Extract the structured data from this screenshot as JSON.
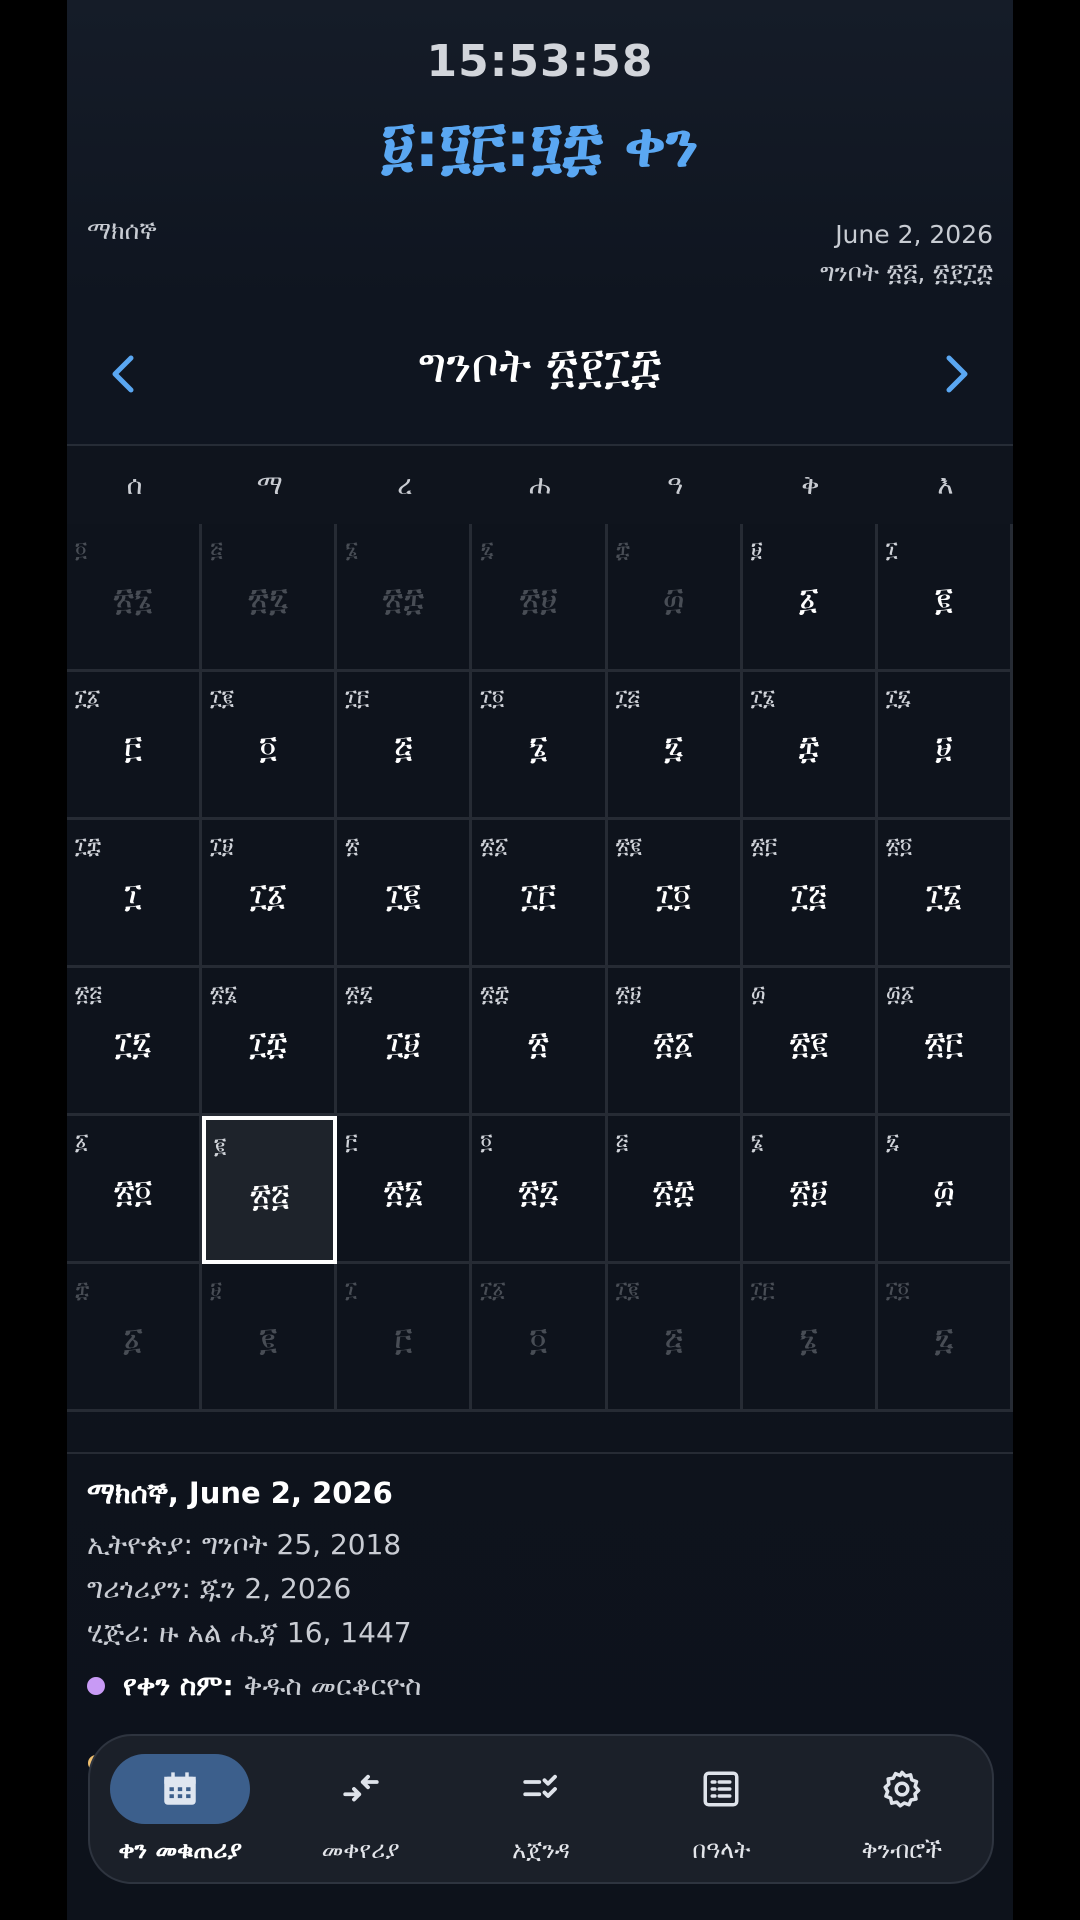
{
  "header": {
    "clock": "15:53:58",
    "title": "፱:፶፫:፶፰ ቀን",
    "weekday": "ማክሰኞ",
    "gregorian_date": "June 2, 2026",
    "ethiopian_date": "ግንቦት ፳፭, ፳፻፲፰"
  },
  "calendar": {
    "month_title": "ግንቦት ፳፻፲፰",
    "weekdays": [
      "ሰ",
      "ማ",
      "ረ",
      "ሐ",
      "ዓ",
      "ቅ",
      "እ"
    ],
    "weeks": [
      [
        {
          "s": "፬",
          "b": "፳፮",
          "o": true
        },
        {
          "s": "፭",
          "b": "፳፯",
          "o": true
        },
        {
          "s": "፮",
          "b": "፳፰",
          "o": true
        },
        {
          "s": "፯",
          "b": "፳፱",
          "o": true
        },
        {
          "s": "፰",
          "b": "፴",
          "o": true
        },
        {
          "s": "፱",
          "b": "፩",
          "o": false
        },
        {
          "s": "፲",
          "b": "፪",
          "o": false
        }
      ],
      [
        {
          "s": "፲፩",
          "b": "፫",
          "o": false
        },
        {
          "s": "፲፪",
          "b": "፬",
          "o": false
        },
        {
          "s": "፲፫",
          "b": "፭",
          "o": false
        },
        {
          "s": "፲፬",
          "b": "፮",
          "o": false
        },
        {
          "s": "፲፭",
          "b": "፯",
          "o": false
        },
        {
          "s": "፲፮",
          "b": "፰",
          "o": false
        },
        {
          "s": "፲፯",
          "b": "፱",
          "o": false
        }
      ],
      [
        {
          "s": "፲፰",
          "b": "፲",
          "o": false
        },
        {
          "s": "፲፱",
          "b": "፲፩",
          "o": false
        },
        {
          "s": "፳",
          "b": "፲፪",
          "o": false
        },
        {
          "s": "፳፩",
          "b": "፲፫",
          "o": false
        },
        {
          "s": "፳፪",
          "b": "፲፬",
          "o": false
        },
        {
          "s": "፳፫",
          "b": "፲፭",
          "o": false
        },
        {
          "s": "፳፬",
          "b": "፲፮",
          "o": false
        }
      ],
      [
        {
          "s": "፳፭",
          "b": "፲፯",
          "o": false
        },
        {
          "s": "፳፮",
          "b": "፲፰",
          "o": false
        },
        {
          "s": "፳፯",
          "b": "፲፱",
          "o": false
        },
        {
          "s": "፳፰",
          "b": "፳",
          "o": false
        },
        {
          "s": "፳፱",
          "b": "፳፩",
          "o": false
        },
        {
          "s": "፴",
          "b": "፳፪",
          "o": false
        },
        {
          "s": "፴፩",
          "b": "፳፫",
          "o": false
        }
      ],
      [
        {
          "s": "፩",
          "b": "፳፬",
          "o": false
        },
        {
          "s": "፪",
          "b": "፳፭",
          "o": false,
          "today": true
        },
        {
          "s": "፫",
          "b": "፳፮",
          "o": false
        },
        {
          "s": "፬",
          "b": "፳፯",
          "o": false
        },
        {
          "s": "፭",
          "b": "፳፰",
          "o": false
        },
        {
          "s": "፮",
          "b": "፳፱",
          "o": false
        },
        {
          "s": "፯",
          "b": "፴",
          "o": false
        }
      ],
      [
        {
          "s": "፰",
          "b": "፩",
          "o": true
        },
        {
          "s": "፱",
          "b": "፪",
          "o": true
        },
        {
          "s": "፲",
          "b": "፫",
          "o": true
        },
        {
          "s": "፲፩",
          "b": "፬",
          "o": true
        },
        {
          "s": "፲፪",
          "b": "፭",
          "o": true
        },
        {
          "s": "፲፫",
          "b": "፮",
          "o": true
        },
        {
          "s": "፲፬",
          "b": "፯",
          "o": true
        }
      ]
    ]
  },
  "details": {
    "heading": "ማክሰኞ, June 2, 2026",
    "ethiopian": "ኢትዮጵያ: ግንቦት 25, 2018",
    "gregorian": "ግሪጎሪያን: ጁን 2, 2026",
    "hijri": "ሂጅሪ: ዙ አል ሒጃ 16, 1447",
    "saint_label": "የቀን ስም:",
    "saint_value": "ቅዱስ መርቆርዮስ"
  },
  "nav": {
    "items": [
      {
        "label": "ቀን መቁጠሪያ",
        "icon": "calendar-icon",
        "active": true
      },
      {
        "label": "መቀየሪያ",
        "icon": "swap-arrows-icon",
        "active": false
      },
      {
        "label": "አጀንዳ",
        "icon": "checklist-icon",
        "active": false
      },
      {
        "label": "በዓላት",
        "icon": "list-icon",
        "active": false
      },
      {
        "label": "ቅንብሮች",
        "icon": "gear-icon",
        "active": false
      }
    ]
  },
  "colors": {
    "accent": "#5aa7f2",
    "active_pill": "#3c5f8c",
    "saint_dot": "#c89af5"
  }
}
